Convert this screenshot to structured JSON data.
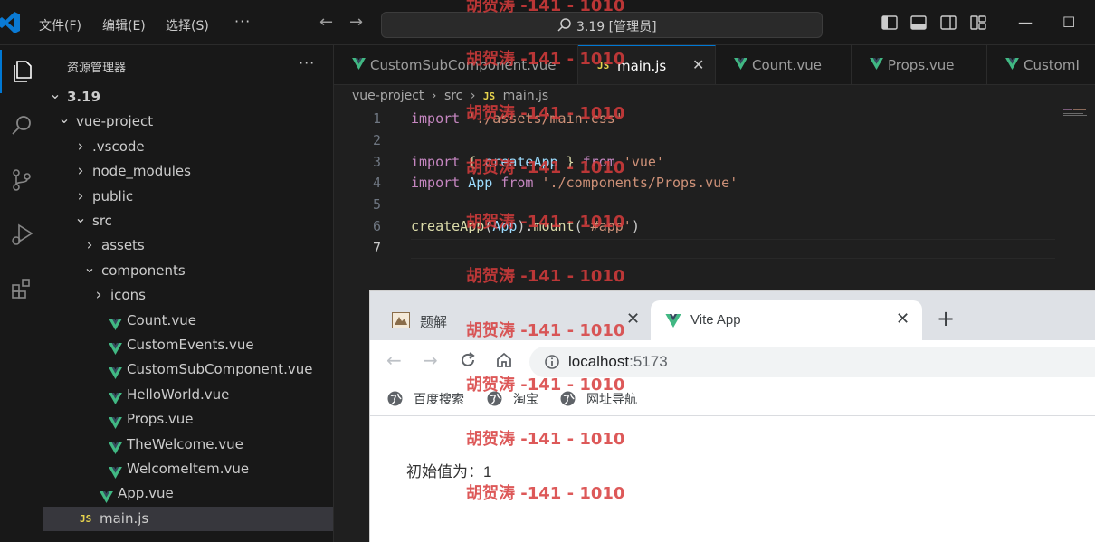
{
  "titlebar": {
    "menu": [
      "文件(F)",
      "编辑(E)",
      "选择(S)"
    ],
    "more": "···",
    "search_text": "3.19 [管理员]"
  },
  "sidebar": {
    "title": "资源管理器",
    "more": "···",
    "tree": [
      {
        "label": "3.19",
        "kind": "folder-open",
        "depth": 0,
        "bold": true
      },
      {
        "label": "vue-project",
        "kind": "folder-open",
        "depth": 1
      },
      {
        "label": ".vscode",
        "kind": "folder-closed",
        "depth": 2
      },
      {
        "label": "node_modules",
        "kind": "folder-closed",
        "depth": 2
      },
      {
        "label": "public",
        "kind": "folder-closed",
        "depth": 2
      },
      {
        "label": "src",
        "kind": "folder-open",
        "depth": 2
      },
      {
        "label": "assets",
        "kind": "folder-closed",
        "depth": 3
      },
      {
        "label": "components",
        "kind": "folder-open",
        "depth": 3
      },
      {
        "label": "icons",
        "kind": "folder-closed",
        "depth": 4
      },
      {
        "label": "Count.vue",
        "kind": "vue",
        "depth": 4
      },
      {
        "label": "CustomEvents.vue",
        "kind": "vue",
        "depth": 4
      },
      {
        "label": "CustomSubComponent.vue",
        "kind": "vue",
        "depth": 4
      },
      {
        "label": "HelloWorld.vue",
        "kind": "vue",
        "depth": 4
      },
      {
        "label": "Props.vue",
        "kind": "vue",
        "depth": 4
      },
      {
        "label": "TheWelcome.vue",
        "kind": "vue",
        "depth": 4
      },
      {
        "label": "WelcomeItem.vue",
        "kind": "vue",
        "depth": 4
      },
      {
        "label": "App.vue",
        "kind": "vue",
        "depth": 3
      },
      {
        "label": "main.js",
        "kind": "js",
        "depth": 3,
        "selected": true
      }
    ]
  },
  "tabs": [
    {
      "label": "CustomSubComponent.vue",
      "kind": "vue"
    },
    {
      "label": "main.js",
      "kind": "js",
      "active": true,
      "close": "✕"
    },
    {
      "label": "Count.vue",
      "kind": "vue"
    },
    {
      "label": "Props.vue",
      "kind": "vue"
    },
    {
      "label": "CustomI",
      "kind": "vue"
    }
  ],
  "breadcrumb": {
    "items": [
      "vue-project",
      "src",
      "main.js"
    ],
    "sep": "›",
    "js_badge": "JS"
  },
  "editor": {
    "line_numbers": [
      "1",
      "2",
      "3",
      "4",
      "5",
      "6",
      "7"
    ],
    "current_line": 7
  },
  "browser": {
    "tabs": [
      {
        "label": "题解",
        "close": "✕"
      },
      {
        "label": "Vite App",
        "close": "✕",
        "active": true
      }
    ],
    "new_tab": "+",
    "url_host": "localhost",
    "url_port": ":5173",
    "bookmarks": [
      "百度搜索",
      "淘宝",
      "网址导航"
    ],
    "page_text": "初始值为：1"
  },
  "watermark": {
    "text": "胡贺涛 -141 - 1010",
    "color": "#d73c3c"
  },
  "colors": {
    "accent": "#0078d4",
    "vue_green": "#41b883",
    "js_yellow": "#e8d44d"
  }
}
